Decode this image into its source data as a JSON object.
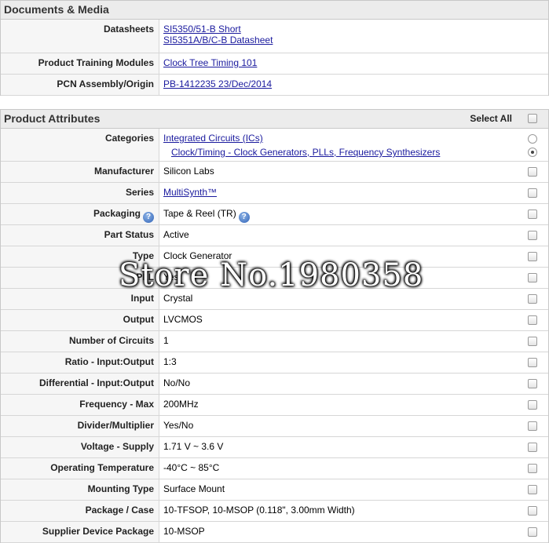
{
  "documents": {
    "title": "Documents & Media",
    "rows": [
      {
        "label": "Datasheets",
        "links": [
          "SI5350/51-B Short",
          "SI5351A/B/C-B Datasheet"
        ]
      },
      {
        "label": "Product Training Modules",
        "links": [
          "Clock Tree Timing 101"
        ]
      },
      {
        "label": "PCN Assembly/Origin",
        "links": [
          "PB-1412235 23/Dec/2014"
        ]
      }
    ]
  },
  "attributes": {
    "title": "Product Attributes",
    "select_all": "Select All",
    "categories": {
      "label": "Categories",
      "options": [
        "Integrated Circuits (ICs)",
        "Clock/Timing - Clock Generators, PLLs, Frequency Synthesizers"
      ],
      "selected_index": 1
    },
    "rows": [
      {
        "label": "Manufacturer",
        "value": "Silicon Labs"
      },
      {
        "label": "Series",
        "value": "MultiSynth™"
      },
      {
        "label": "Packaging",
        "value": "Tape & Reel (TR)"
      },
      {
        "label": "Part Status",
        "value": "Active"
      },
      {
        "label": "Type",
        "value": "Clock Generator"
      },
      {
        "label": "PLL",
        "value": "Yes"
      },
      {
        "label": "Input",
        "value": "Crystal"
      },
      {
        "label": "Output",
        "value": "LVCMOS"
      },
      {
        "label": "Number of Circuits",
        "value": "1"
      },
      {
        "label": "Ratio - Input:Output",
        "value": "1:3"
      },
      {
        "label": "Differential - Input:Output",
        "value": "No/No"
      },
      {
        "label": "Frequency - Max",
        "value": "200MHz"
      },
      {
        "label": "Divider/Multiplier",
        "value": "Yes/No"
      },
      {
        "label": "Voltage - Supply",
        "value": "1.71 V ~ 3.6 V"
      },
      {
        "label": "Operating Temperature",
        "value": "-40°C ~ 85°C"
      },
      {
        "label": "Mounting Type",
        "value": "Surface Mount"
      },
      {
        "label": "Package / Case",
        "value": "10-TFSOP, 10-MSOP (0.118\", 3.00mm Width)"
      },
      {
        "label": "Supplier Device Package",
        "value": "10-MSOP"
      }
    ]
  },
  "watermark": "Store No.1980358"
}
